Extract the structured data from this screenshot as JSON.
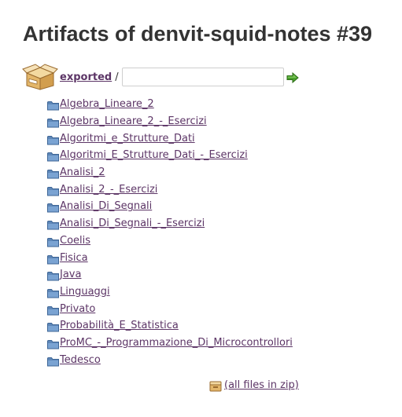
{
  "page": {
    "title": "Artifacts of denvit-squid-notes #39"
  },
  "breadcrumb": {
    "root_label": "exported",
    "separator": "/",
    "path_input_value": "",
    "icons": {
      "root": "archive-box-icon",
      "go": "go-arrow-icon"
    }
  },
  "directories": [
    {
      "label": "Algebra_Lineare_2",
      "icon": "folder-icon"
    },
    {
      "label": "Algebra_Lineare_2_-_Esercizi",
      "icon": "folder-icon"
    },
    {
      "label": "Algoritmi_e_Strutture_Dati",
      "icon": "folder-icon"
    },
    {
      "label": "Algoritmi_E_Strutture_Dati_-_Esercizi",
      "icon": "folder-icon"
    },
    {
      "label": "Analisi_2",
      "icon": "folder-icon"
    },
    {
      "label": "Analisi_2_-_Esercizi",
      "icon": "folder-icon"
    },
    {
      "label": "Analisi_Di_Segnali",
      "icon": "folder-icon"
    },
    {
      "label": "Analisi_Di_Segnali_-_Esercizi",
      "icon": "folder-icon"
    },
    {
      "label": "Coelis",
      "icon": "folder-icon"
    },
    {
      "label": "Fisica",
      "icon": "folder-icon"
    },
    {
      "label": "Java",
      "icon": "folder-icon"
    },
    {
      "label": "Linguaggi",
      "icon": "folder-icon"
    },
    {
      "label": "Privato",
      "icon": "folder-icon"
    },
    {
      "label": "Probabilità_E_Statistica",
      "icon": "folder-icon"
    },
    {
      "label": "ProMC_-_Programmazione_Di_Microcontrollori",
      "icon": "folder-icon"
    },
    {
      "label": "Tedesco",
      "icon": "folder-icon"
    }
  ],
  "zip": {
    "label": "(all files in zip)",
    "icon": "zip-archive-icon"
  },
  "colors": {
    "link": "#5c3566",
    "text": "#333333",
    "folder": "#5e87b8",
    "go_arrow": "#4aa02c"
  }
}
